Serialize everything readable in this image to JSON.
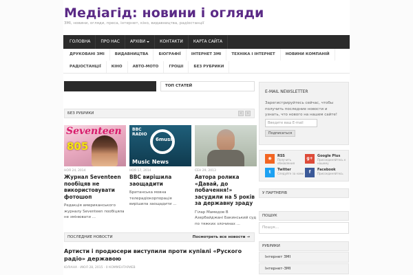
{
  "site": {
    "title": "Медіагід: новини і огляди",
    "description": "ЗМІ, новини, огляди, преса, інтернет, кіно, видавництва, радіостанції"
  },
  "main_nav": [
    {
      "label": "ГОЛОВНА",
      "dropdown": false
    },
    {
      "label": "ПРО НАС",
      "dropdown": false
    },
    {
      "label": "АРХІВИ",
      "dropdown": true
    },
    {
      "label": "КОНТАКТИ",
      "dropdown": false
    },
    {
      "label": "КАРТА САЙТА",
      "dropdown": false
    }
  ],
  "sub_nav": [
    "ДРУКОВАНІ ЗМІ",
    "ВИДАВНИЦТВА",
    "БІОГРАФІЇ",
    "ІНТЕРНЕТ ЗМІ",
    "ТЕХНІКА І ІНТЕРНЕТ",
    "НОВИНИ КОМПАНІЙ",
    "РАДІОСТАНЦІЇ",
    "КІНО",
    "АВТО-МОТО",
    "ГРОШІ",
    "БЕЗ РУБРИКИ"
  ],
  "tabs": {
    "top_articles": "ТОП СТАТЕЙ"
  },
  "section": {
    "title": "БЕЗ РУБРИКИ",
    "prev": "‹",
    "next": "›"
  },
  "cards": [
    {
      "thumb_text": "Seventeen",
      "thumb_sub": "805",
      "date": "НОЯ 24, 2014",
      "title": "Журнал Seventeen пообіцяв не використовувати фотошоп",
      "excerpt": "Редакція американського журналу Seventeen пообіцяла не змінювати ..."
    },
    {
      "thumb_text": "BBC RADIO",
      "thumb_sub": "6music",
      "thumb_caption": "Music News",
      "date": "НОЯ 17, 2014",
      "title": "BBC вирішила заощадити",
      "excerpt": "Британська мовна телерадіокорпорація вирішила заощадити ..."
    },
    {
      "date": "СЕН 29, 2013",
      "title": "Автора ролика «Давай, до побачення!» засудили на 5 років за державну зраду",
      "excerpt": "Гілар Мамедов В Азербайджані Бакинський суд по тяжких злочинах ..."
    }
  ],
  "latest": {
    "label": "ПОСЛЕДНИЕ НОВОСТИ",
    "all_link": "Посмотреть все новости →",
    "post_title": "Артисти і продюсери виступили проти купівлі «Руского радіо» державою",
    "post_meta": "ЮЛІАНА · ИЮЛ 28, 2015 · 0 КОММЕНТАРИЕВ"
  },
  "newsletter": {
    "title": "E-MAIL NEWSLETTER",
    "text": "Зарегистрируйтесь сейчас, чтобы получить последние новости и узнать, что нового на нашем сайте!",
    "placeholder": "Введите ваш E-mail",
    "button": "Подписаться"
  },
  "social": [
    {
      "name": "RSS",
      "desc": "Получить обновления",
      "icon": "rss-icon",
      "color": "#f26522",
      "glyph": "◉"
    },
    {
      "name": "Google Plus",
      "desc": "Присоединяйтесь к нашему",
      "icon": "google-plus-icon",
      "color": "#dd4b39",
      "glyph": "g+"
    },
    {
      "name": "Twitter",
      "desc": "Следуйте за нами",
      "icon": "twitter-icon",
      "color": "#1da1f2",
      "glyph": "t"
    },
    {
      "name": "Facebook",
      "desc": "Присоединяйтесь",
      "icon": "facebook-icon",
      "color": "#3b5998",
      "glyph": "f"
    }
  ],
  "sidebar": {
    "partners": "У ПАРТНЕРІВ",
    "search_title": "ПОШУК",
    "search_placeholder": "Пошук...",
    "categories_title": "РУБРИКИ",
    "categories": [
      "Інтернет ЗМІ",
      "Інтернет-ЗМІ"
    ]
  },
  "colors": {
    "brand": "#5b2a86",
    "nav": "#2b2b2b"
  }
}
